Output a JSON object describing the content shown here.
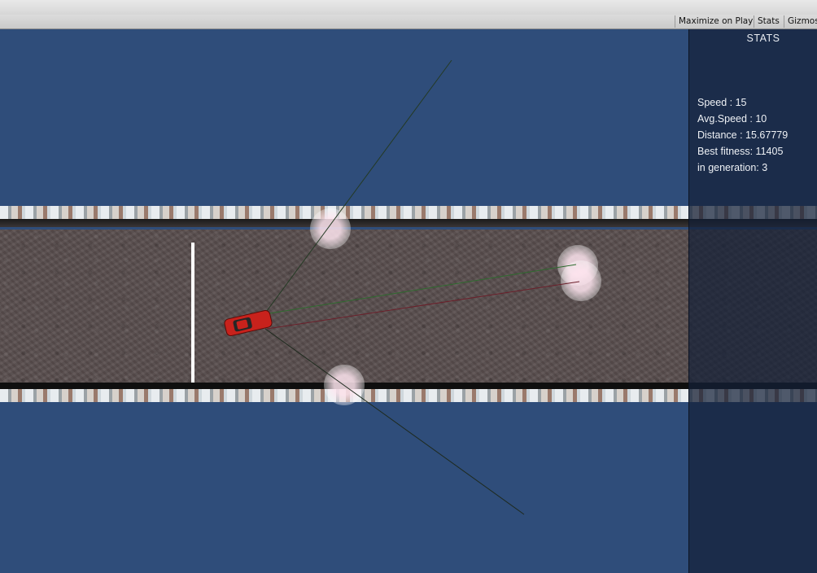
{
  "toolbar": {
    "maximize_on_play": "Maximize on Play",
    "stats": "Stats",
    "gizmos": "Gizmos"
  },
  "stats": {
    "title": "STATS",
    "speed": "Speed : 15",
    "avg_speed": "Avg.Speed : 10",
    "distance": "Distance : 15.67779",
    "best_fitness": "Best fitness: 11405",
    "generation": "in generation: 3"
  },
  "colors": {
    "sky": "#2f4d7a",
    "road": "#5a4f4f",
    "car": "#c8221c",
    "ray_green": "#2e6b2e",
    "ray_red": "#6b1f2a",
    "ray_dark": "#1e2a1e"
  },
  "icons": {
    "car": "red-car-sprite",
    "sensor": "sensor-hit-glow"
  }
}
